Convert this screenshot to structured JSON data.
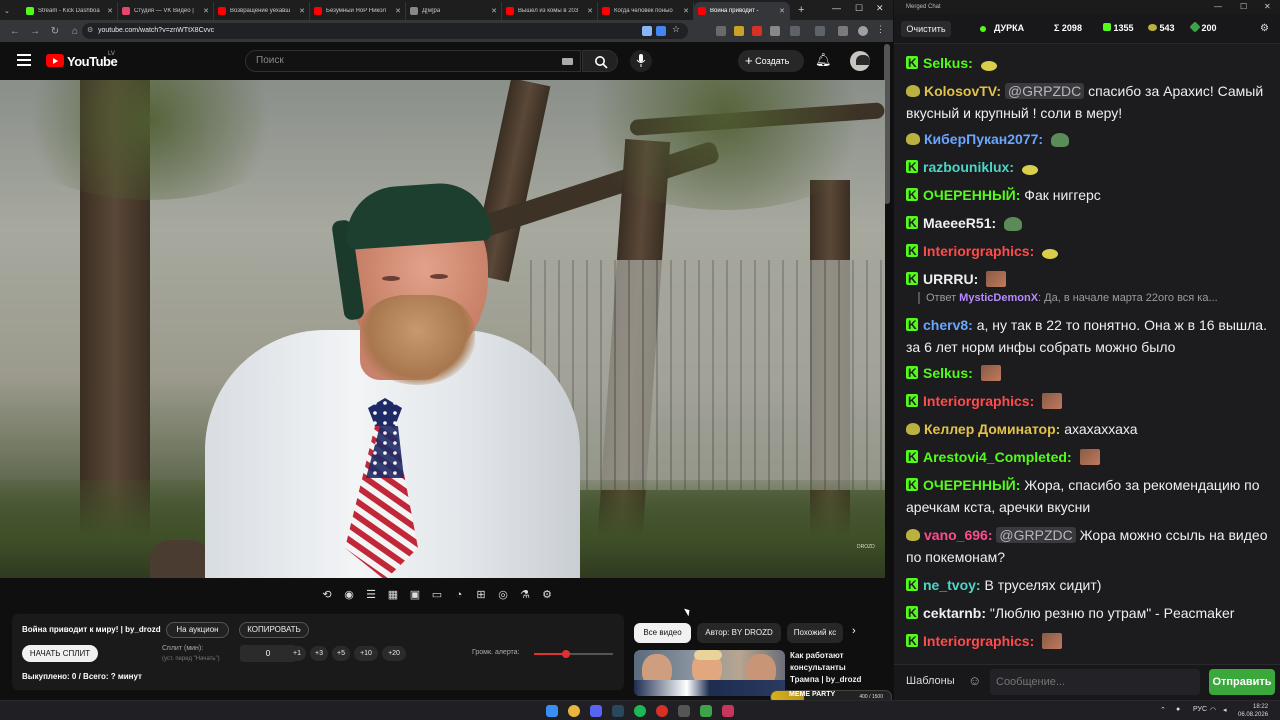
{
  "browser": {
    "tabs": [
      {
        "label": "Stream - Kick Dashboa",
        "color": "#53fc18"
      },
      {
        "label": "Студия — VK Видео |",
        "color": "#e5476b"
      },
      {
        "label": "Возвращение уехавш",
        "color": "#ff0000"
      },
      {
        "label": "Безумный ЯоР Никол",
        "color": "#ff0000"
      },
      {
        "label": "Д[м]ра",
        "color": "#888888"
      },
      {
        "label": "Вышел из комы в 203",
        "color": "#ff0000"
      },
      {
        "label": "Когда человек поныо",
        "color": "#ff0000"
      },
      {
        "label": "Война приводит -",
        "color": "#ff0000",
        "active": true
      }
    ],
    "url": "youtube.com/watch?v=znWTtX8Cvvc"
  },
  "youtube": {
    "logo_text": "YouTube",
    "region": "LV",
    "search_placeholder": "Поиск",
    "create_label": "Создать",
    "video_watermark": "DROZD"
  },
  "auction": {
    "title": "Война приводит к миру! | by_drozd",
    "on_auction_label": "На аукцион",
    "copy_label": "КОПИРОВАТЬ",
    "start_split_label": "НАЧАТЬ СПЛИТ",
    "split_label": "Сплит (мин):",
    "split_hint": "(уст. перед \"Начать\")",
    "split_value": "0",
    "increments": [
      "+1",
      "+3",
      "+5",
      "+10",
      "+20"
    ],
    "bought_text": "Выкуплено: 0 / Всего: ? минут",
    "alert_volume_label": "Громк. алерта:",
    "alert_volume_fraction": 0.4,
    "accent": "#e03131"
  },
  "chips": [
    {
      "label": "Все видео",
      "active": true
    },
    {
      "label": "Автор: BY DROZD",
      "active": false
    },
    {
      "label": "Похожий кс",
      "active": false
    }
  ],
  "recommendation": {
    "title": "Как работают консультанты Трампа | by_drozd",
    "thumb_banner": "MEME PARTY"
  },
  "chat": {
    "window_title": "Merged Chat",
    "clear_label": "Очистить",
    "channel": "ДУРКА",
    "stats": [
      {
        "icon": "Σ",
        "value": "2098"
      },
      {
        "icon": "K",
        "value": "1355"
      },
      {
        "icon": "p",
        "value": "543"
      },
      {
        "icon": "g",
        "value": "200"
      }
    ],
    "accent": "#53fc18",
    "messages": [
      {
        "badge": "kick",
        "user": "Selkus",
        "color": "#53fc18",
        "text": "",
        "emote": "wormy"
      },
      {
        "badge": "peanut",
        "user": "KolosovTV",
        "color": "#e3c24a",
        "mention": "@GRPZDC",
        "text": "спасибо за Арахис! Самый вкусный и крупный ! соли в меру!",
        "emote": ""
      },
      {
        "badge": "peanut",
        "user": "КиберПукан2077",
        "color": "#6aa6ff",
        "text": "",
        "emote": "frog"
      },
      {
        "badge": "kick",
        "user": "razbouniklux",
        "color": "#4fd4c6",
        "text": "",
        "emote": "wormy"
      },
      {
        "badge": "kick",
        "user": "ОЧЕРЕННЫЙ",
        "color": "#53fc18",
        "text": "Фак ниггерс",
        "emote": ""
      },
      {
        "badge": "kick",
        "user": "MaeeeR51",
        "color": "#efeff1",
        "text": "",
        "emote": "frog"
      },
      {
        "badge": "kick",
        "user": "Interiorgraphics",
        "color": "#ff4b4b",
        "text": "",
        "emote": "wormy"
      },
      {
        "badge": "kick",
        "user": "URRRU",
        "color": "#efeff1",
        "text": "",
        "emote": "pic"
      },
      {
        "badge": "kick",
        "user": "cherv8",
        "color": "#6aa6ff",
        "text": "а, ну так в 22 то понятно. Она ж в 16 вышла. за 6 лет норм инфы собрать можно было",
        "emote": "",
        "reply": {
          "prefix": "Ответ",
          "user": "MysticDemonX",
          "text": "Да, в начале марта 22ого вся ка..."
        }
      },
      {
        "badge": "kick",
        "user": "Selkus",
        "color": "#53fc18",
        "text": "",
        "emote": "pic"
      },
      {
        "badge": "kick",
        "user": "Interiorgraphics",
        "color": "#ff4b4b",
        "text": "",
        "emote": "pic"
      },
      {
        "badge": "peanut",
        "user": "Келлер Доминатор",
        "color": "#e3c24a",
        "text": "ахахаххаха",
        "emote": ""
      },
      {
        "badge": "kick",
        "user": "Arestovi4_Completed",
        "color": "#53fc18",
        "text": "",
        "emote": "pic"
      },
      {
        "badge": "kick",
        "user": "ОЧЕРЕННЫЙ",
        "color": "#53fc18",
        "text": "Жора, спасибо за рекомендацию по аречкам кста, аречки вкусни",
        "emote": ""
      },
      {
        "badge": "peanut",
        "user": "vano_696",
        "color": "#ff4b8f",
        "mention": "@GRPZDC",
        "text": "Жора можно ссыль на видео по покемонам?",
        "emote": ""
      },
      {
        "badge": "kick",
        "user": "ne_tvoy",
        "color": "#4fd4c6",
        "text": "В труселях сидит)",
        "emote": ""
      },
      {
        "badge": "kick",
        "user": "cektarnb",
        "color": "#efeff1",
        "text": "\"Люблю резню по утрам\" - Peacmaker",
        "emote": ""
      },
      {
        "badge": "kick",
        "user": "Interiorgraphics",
        "color": "#ff4b4b",
        "text": "",
        "emote": "pic"
      }
    ],
    "templates_label": "Шаблоны",
    "input_placeholder": "Сообщение...",
    "send_label": "Отправить"
  },
  "taskbar": {
    "overlay_progress": "400 / 1500",
    "overlay_progress_fraction": 0.27,
    "lang": "РУС",
    "time": "18:22",
    "date": "06.08.2026"
  }
}
